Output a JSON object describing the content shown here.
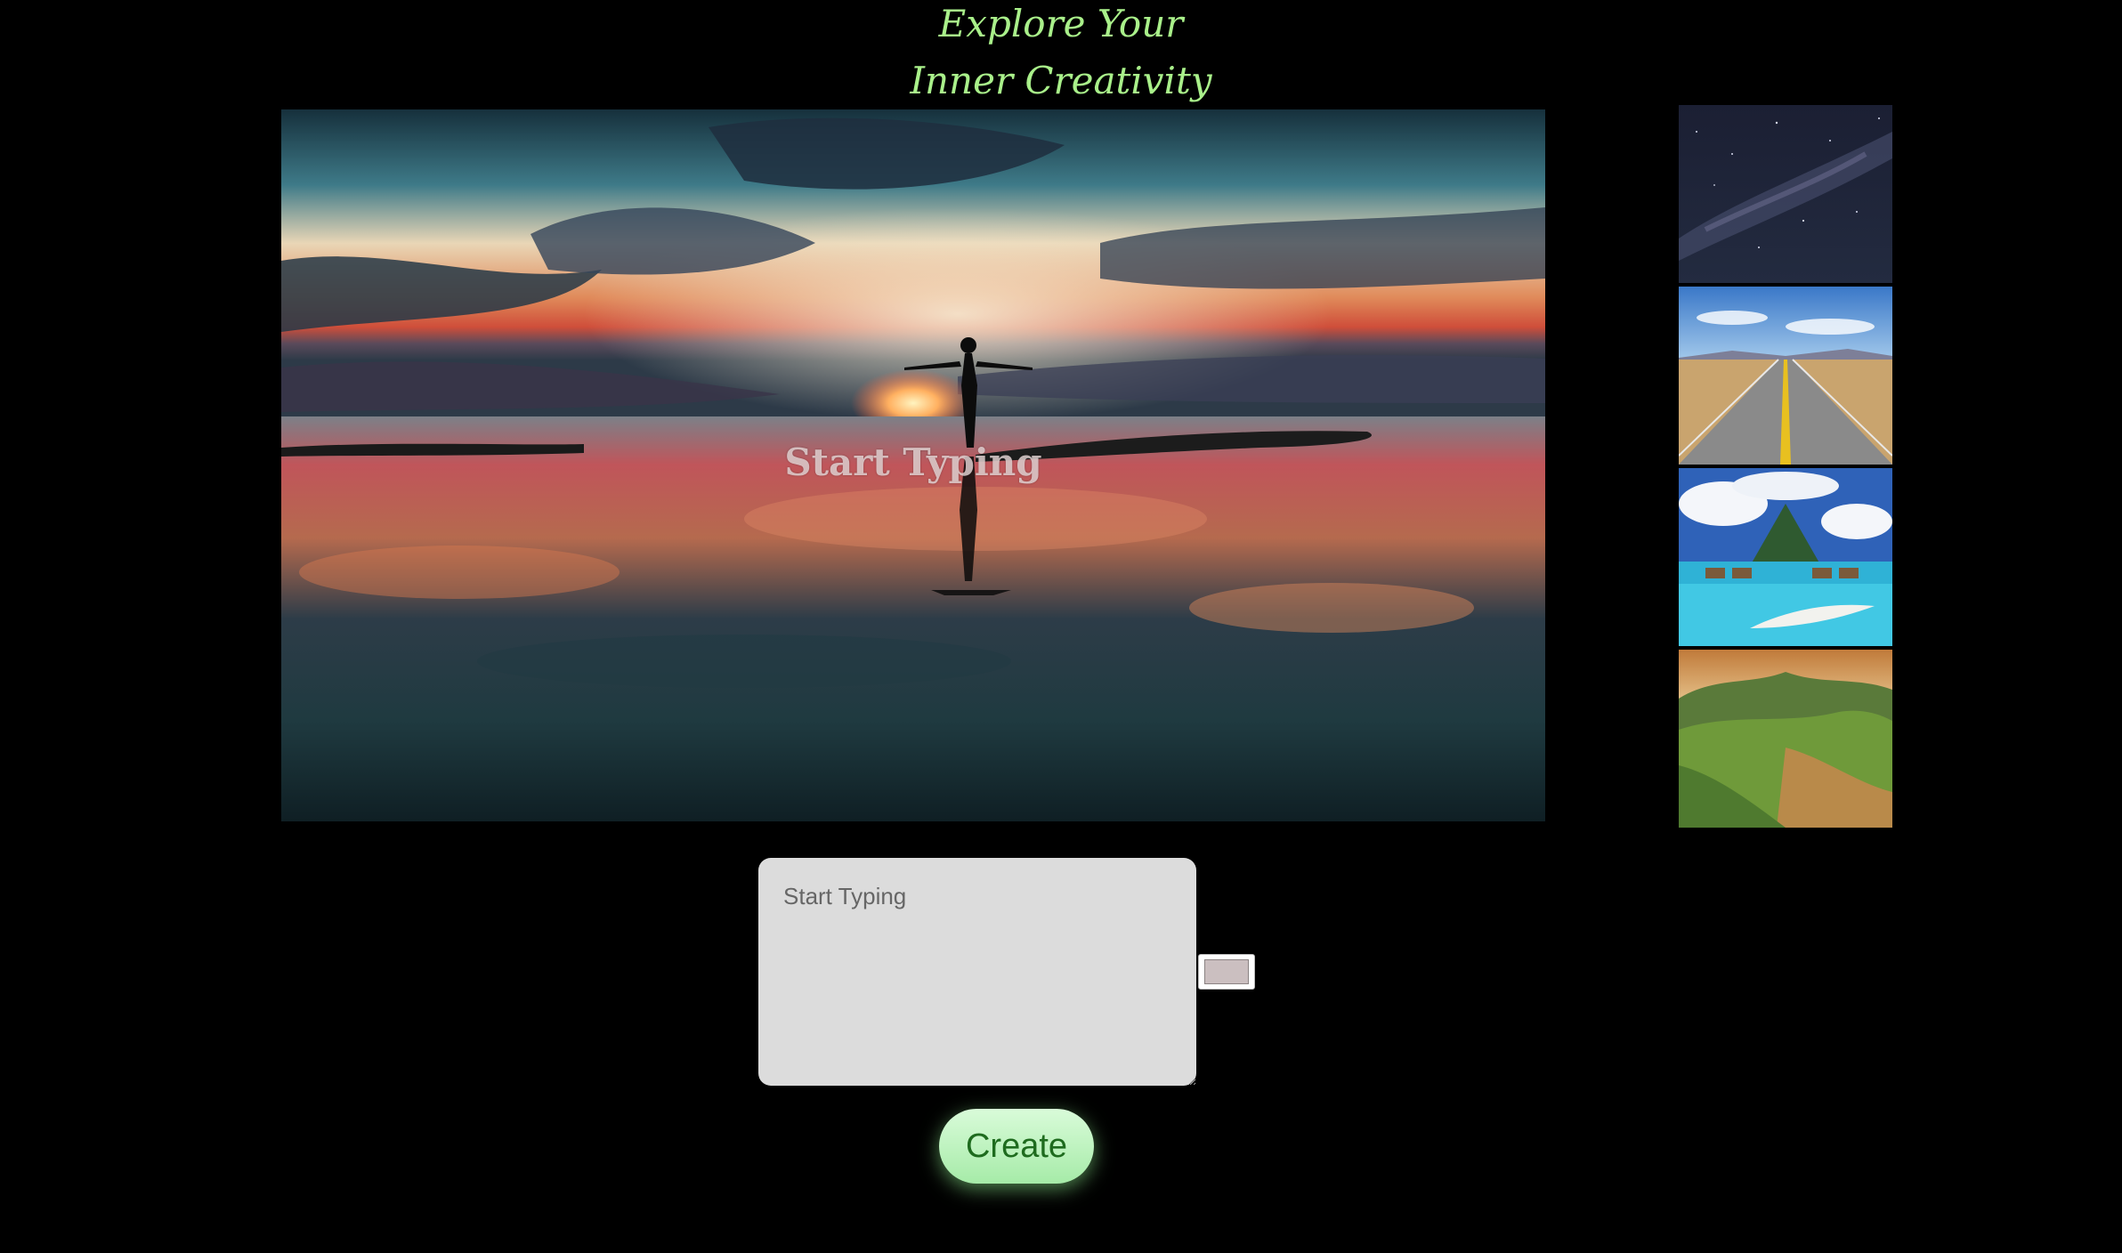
{
  "header": {
    "title_line1": "Explore Your",
    "title_line2": "Inner Creativity"
  },
  "preview": {
    "caption": "Start Typing",
    "image": "sunset-beach-silhouette-image"
  },
  "thumbnails": [
    {
      "name": "milky-way-night-sky"
    },
    {
      "name": "desert-road"
    },
    {
      "name": "tropical-island-bungalows"
    },
    {
      "name": "green-hills-valley"
    }
  ],
  "editor": {
    "placeholder": "Start Typing",
    "color_value": "#cbbfc0"
  },
  "actions": {
    "create_label": "Create"
  },
  "colors": {
    "background": "#000000",
    "title": "#a9f08a",
    "button_bg": "#b8f2b8",
    "button_text": "#1e6b1e"
  }
}
